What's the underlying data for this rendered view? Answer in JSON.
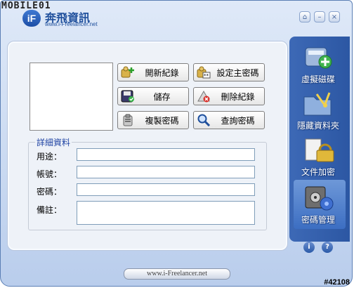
{
  "watermark": "MOBILE01",
  "brand": {
    "badge": "iF",
    "name": "奔飛資訊",
    "url": "www.i-Freelancer.net"
  },
  "buttons": {
    "open": "開新紀錄",
    "set_master": "設定主密碼",
    "save": "儲存",
    "delete": "刪除紀錄",
    "copy": "複製密碼",
    "query": "查詢密碼"
  },
  "details": {
    "title": "詳細資料",
    "purpose_label": "用途：",
    "account_label": "帳號：",
    "password_label": "密碼：",
    "note_label": "備註：",
    "purpose_value": "",
    "account_value": "",
    "password_value": "",
    "note_value": ""
  },
  "sidebar": {
    "items": [
      {
        "label": "虛擬磁碟",
        "icon": "virtual-disk-icon"
      },
      {
        "label": "隱藏資料夾",
        "icon": "hidden-folder-icon"
      },
      {
        "label": "文件加密",
        "icon": "file-encrypt-icon"
      },
      {
        "label": "密碼管理",
        "icon": "password-manager-icon",
        "selected": true
      }
    ]
  },
  "footer": {
    "url": "www.i-Freelancer.net"
  },
  "corner_tag": "#42108",
  "colors": {
    "accent": "#2c57a3",
    "group_title": "#2145a4",
    "frame": "#c9d9f1"
  }
}
